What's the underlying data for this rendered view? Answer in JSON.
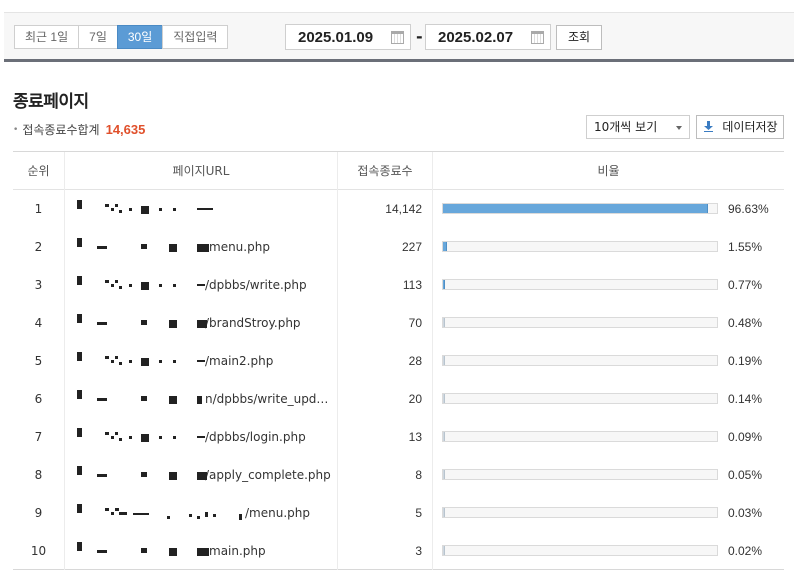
{
  "filters": {
    "periods": [
      {
        "label": "최근 1일",
        "active": false
      },
      {
        "label": "7일",
        "active": false
      },
      {
        "label": "30일",
        "active": true
      },
      {
        "label": "직접입력",
        "active": false
      }
    ],
    "start_date": "2025.01.09",
    "end_date": "2025.02.07",
    "separator": "-",
    "search_label": "조회"
  },
  "section": {
    "title": "종료페이지",
    "summary_label": "접속종료수합계",
    "summary_total": "14,635",
    "page_size": "10개씩 보기",
    "save_label": "데이터저장"
  },
  "table": {
    "headers": [
      "순위",
      "페이지URL",
      "접속종료수",
      "비율"
    ],
    "rows": [
      {
        "rank": "1",
        "url": "",
        "count": "14,142",
        "percent": "96.63%",
        "ratio": 0.9663
      },
      {
        "rank": "2",
        "url": "menu.php",
        "count": "227",
        "percent": "1.55%",
        "ratio": 0.0155
      },
      {
        "rank": "3",
        "url": "/dpbbs/write.php",
        "count": "113",
        "percent": "0.77%",
        "ratio": 0.0077
      },
      {
        "rank": "4",
        "url": "/brandStroy.php",
        "count": "70",
        "percent": "0.48%",
        "ratio": 0.0048
      },
      {
        "rank": "5",
        "url": "/main2.php",
        "count": "28",
        "percent": "0.19%",
        "ratio": 0.0019
      },
      {
        "rank": "6",
        "url": "n/dpbbs/write_update.php",
        "count": "20",
        "percent": "0.14%",
        "ratio": 0.0014
      },
      {
        "rank": "7",
        "url": "/dpbbs/login.php",
        "count": "13",
        "percent": "0.09%",
        "ratio": 0.0009
      },
      {
        "rank": "8",
        "url": "/apply_complete.php",
        "count": "8",
        "percent": "0.05%",
        "ratio": 0.0005
      },
      {
        "rank": "9",
        "url": "/menu.php",
        "count": "5",
        "percent": "0.03%",
        "ratio": 0.0003
      },
      {
        "rank": "10",
        "url": "main.php",
        "count": "3",
        "percent": "0.02%",
        "ratio": 0.0002
      }
    ]
  },
  "colors": {
    "accent": "#5b9bd5",
    "bar": "#67a7db",
    "total": "#e0502b"
  }
}
